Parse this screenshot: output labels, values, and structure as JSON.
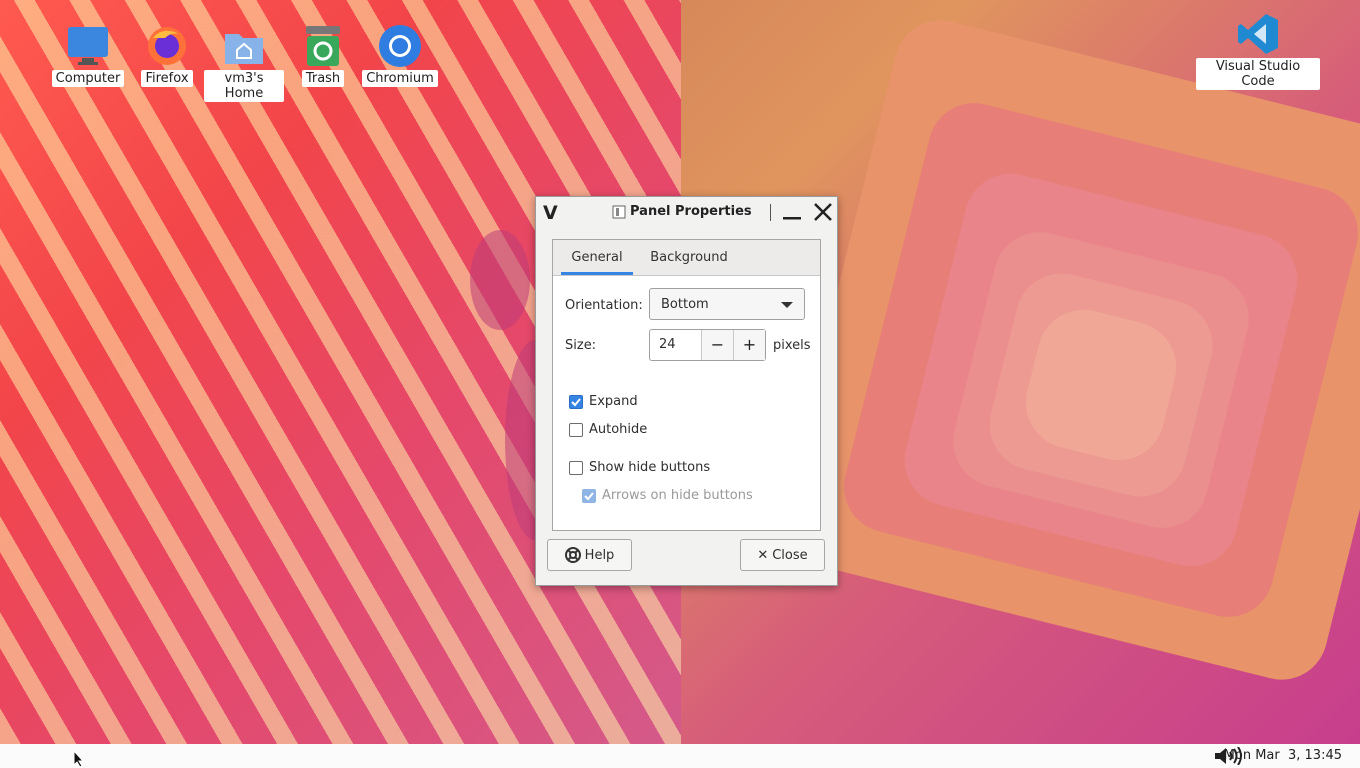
{
  "desktop": {
    "icons": [
      {
        "label": "Computer",
        "icon": "monitor-icon"
      },
      {
        "label": "Firefox",
        "icon": "firefox-icon"
      },
      {
        "label": "vm3's Home",
        "icon": "home-folder-icon"
      },
      {
        "label": "Trash",
        "icon": "trash-icon"
      },
      {
        "label": "Chromium",
        "icon": "chromium-icon"
      },
      {
        "label": "Visual Studio Code",
        "icon": "vscode-icon"
      }
    ]
  },
  "dialog": {
    "title": "Panel Properties",
    "tabs": [
      {
        "label": "General",
        "active": true
      },
      {
        "label": "Background",
        "active": false
      }
    ],
    "orientation_label": "Orientation:",
    "orientation_value": "Bottom",
    "size_label": "Size:",
    "size_value": "24",
    "size_unit": "pixels",
    "decrement_symbol": "−",
    "increment_symbol": "+",
    "checkboxes": [
      {
        "label": "Expand",
        "checked": true,
        "enabled": true
      },
      {
        "label": "Autohide",
        "checked": false,
        "enabled": true
      },
      {
        "label": "Show hide buttons",
        "checked": false,
        "enabled": true
      },
      {
        "label": "Arrows on hide buttons",
        "checked": true,
        "enabled": false
      }
    ],
    "help_label": "Help",
    "close_label": "Close"
  },
  "panel": {
    "clock": "Mon Mar  3, 13:45"
  },
  "colors": {
    "accent": "#3584e4",
    "dialog_bg": "#f2f2f1",
    "panel_bg": "#fbfbfb"
  }
}
